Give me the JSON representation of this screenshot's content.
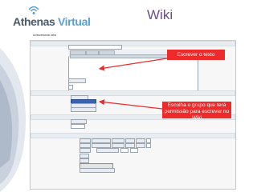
{
  "header": {
    "logo_part1": "Athenas ",
    "logo_part2": "Virtual",
    "title": "Wiki"
  },
  "colors": {
    "title": "#6a4f86",
    "logo_dark": "#4a5a6c",
    "logo_blue": "#5aa0d2",
    "callout": "#ee2a2a",
    "selected_option": "#3a62b0"
  },
  "form": {
    "top_link": "Acrescentando wikis"
  },
  "callouts": {
    "editor_hint": "Escrever o texto",
    "group_hint": "Escolha o grupo que terá permissão para escrever no Wiki"
  }
}
